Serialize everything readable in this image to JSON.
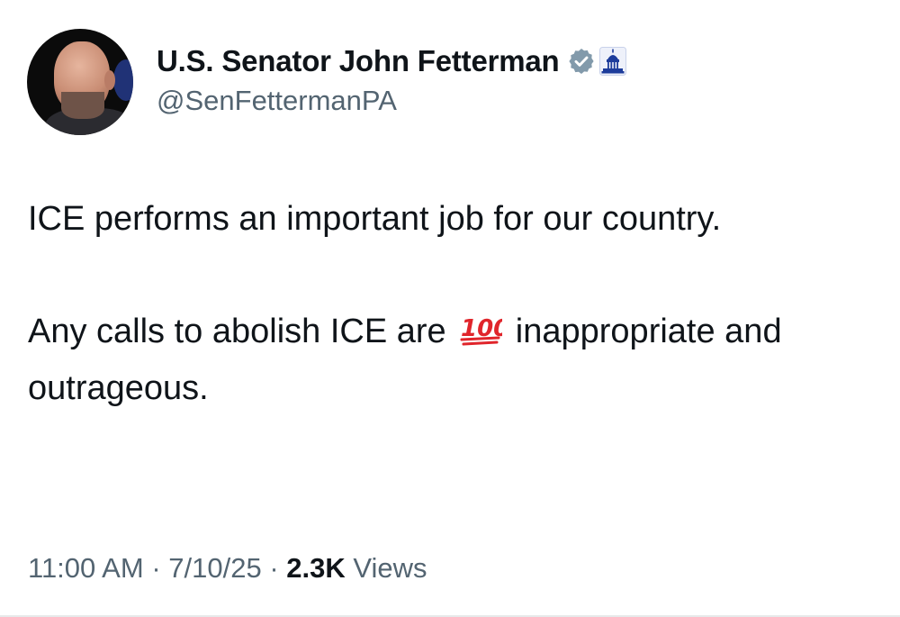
{
  "author": {
    "display_name": "U.S. Senator John Fetterman",
    "handle": "@SenFettermanPA",
    "verified_badge_icon": "gray-checkmark-badge-icon",
    "affiliate_icon": "us-capitol-icon"
  },
  "tweet": {
    "paragraph1": "ICE performs an important job for our country.",
    "paragraph2_before_emoji": "Any calls to abolish ICE are ",
    "emoji_icon": "hundred-points-emoji-icon",
    "paragraph2_after_emoji": " inappropriate and outrageous."
  },
  "meta": {
    "time": "11:00 AM",
    "separator": "·",
    "date": "7/10/25",
    "views_count": "2.3K",
    "views_label": "Views"
  },
  "colors": {
    "primary_text": "#0f1419",
    "secondary_text": "#536471",
    "badge_gray": "#829aab",
    "emoji_red": "#e0252b"
  }
}
